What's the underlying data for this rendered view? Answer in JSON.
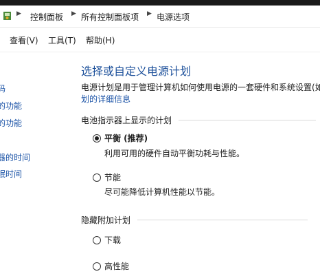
{
  "breadcrumb": {
    "items": [
      "控制面板",
      "所有控制面板项",
      "电源选项"
    ]
  },
  "menu": {
    "items": [
      "查看(V)",
      "工具(T)",
      "帮助(H)"
    ]
  },
  "sidebar": {
    "links": [
      "码",
      "的功能",
      "的功能",
      "器的时间",
      "眠时间"
    ]
  },
  "main": {
    "title": "选择或自定义电源计划",
    "description": "电源计划是用于管理计算机如何使用电源的一套硬件和系统设置(如",
    "link": "划的详细信息",
    "battery_group": "电池指示器上显示的计划",
    "hidden_group": "隐藏附加计划",
    "plans": [
      {
        "name": "平衡 (推荐)",
        "desc": "利用可用的硬件自动平衡功耗与性能。",
        "selected": true
      },
      {
        "name": "节能",
        "desc": "尽可能降低计算机性能以节能。",
        "selected": false
      },
      {
        "name": "下载",
        "desc": "",
        "selected": false
      },
      {
        "name": "高性能",
        "desc": "",
        "selected": false
      }
    ]
  },
  "colors": {
    "link": "#1f56a8",
    "title": "#1b4f9a"
  },
  "icons": {
    "control_panel": "control-panel-icon",
    "separator": "chevron-right-icon"
  }
}
